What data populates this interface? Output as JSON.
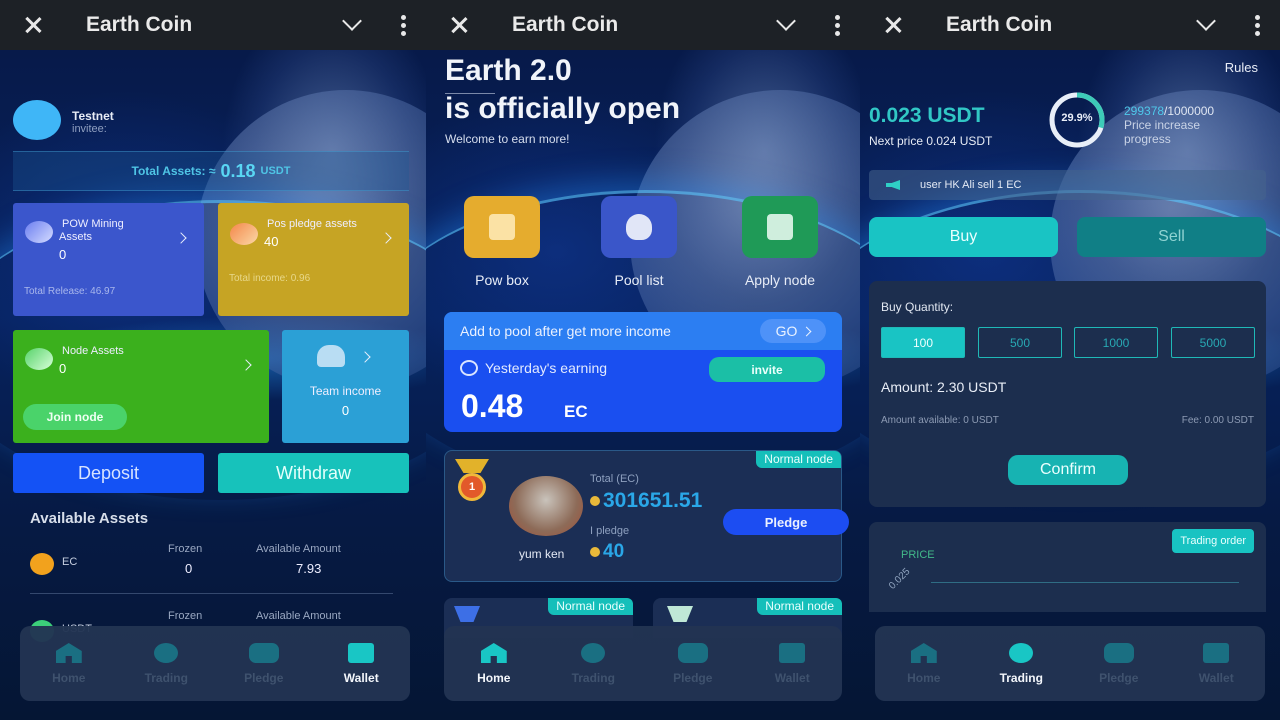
{
  "app": {
    "title": "Earth Coin",
    "close_icon": "close-icon",
    "collapse_icon": "chevron-down-icon",
    "menu_icon": "more-vertical-icon"
  },
  "tabs": [
    "Home",
    "Trading",
    "Pledge",
    "Wallet"
  ],
  "wallet": {
    "user_name": "Testnet",
    "invitee_label": "invitee:",
    "total_assets_label": "Total Assets: ≈",
    "total_assets_value": "0.18",
    "total_assets_unit": "USDT",
    "cards": {
      "pow": {
        "title_1": "POW Mining",
        "title_2": "Assets",
        "value": "0",
        "sub": "Total Release: 46.97",
        "color": "#3b56cc"
      },
      "pos": {
        "title": "Pos pledge assets",
        "value": "40",
        "sub": "Total income: 0.96",
        "color": "#c6a424"
      },
      "node": {
        "title": "Node Assets",
        "value": "0",
        "button": "Join node",
        "color": "#3bb01d"
      },
      "team": {
        "title": "Team income",
        "value": "0",
        "color": "#2ba0d6"
      }
    },
    "deposit_label": "Deposit",
    "withdraw_label": "Withdraw",
    "available_assets_title": "Available Assets",
    "assets": [
      {
        "symbol": "EC",
        "frozen_label": "Frozen",
        "frozen": "0",
        "available_label": "Available Amount",
        "available": "7.93"
      },
      {
        "symbol": "USDT",
        "frozen_label": "Frozen",
        "frozen": "",
        "available_label": "Available Amount",
        "available": ""
      }
    ],
    "active_tab": "Wallet"
  },
  "home": {
    "hero_line1": "Earth 2.0",
    "hero_line2": "is officially open",
    "hero_sub": "Welcome to earn more!",
    "quick_actions": [
      {
        "label": "Pow box",
        "icon": "gift-box-icon",
        "color": "#e5ac2e"
      },
      {
        "label": "Pool list",
        "icon": "trophy-icon",
        "color": "#3a56c9"
      },
      {
        "label": "Apply node",
        "icon": "chip-icon",
        "color": "#1f9a57"
      }
    ],
    "pool_banner": "Add to pool after get more income",
    "go_label": "GO",
    "yesterday_label": "Yesterday's earning",
    "invite_label": "invite",
    "earning_value": "0.48",
    "earning_unit": "EC",
    "node_card": {
      "badge": "Normal node",
      "rank": "1",
      "name": "yum ken",
      "total_label": "Total (EC)",
      "total_value": "301651.51",
      "pledge_label": "I pledge",
      "pledge_value": "40",
      "pledge_button": "Pledge"
    },
    "more_nodes": [
      {
        "badge": "Normal node"
      },
      {
        "badge": "Normal node"
      }
    ],
    "active_tab": "Home"
  },
  "trading": {
    "rules_label": "Rules",
    "current_price": "0.023 USDT",
    "next_price": "Next price 0.024 USDT",
    "progress_percent": 29.9,
    "progress_label": "29.9%",
    "progress_current": "299378",
    "progress_total": "/1000000",
    "progress_caption_1": "Price increase",
    "progress_caption_2": "progress",
    "ticker": "user HK Ali sell 1 EC",
    "buy_label": "Buy",
    "sell_label": "Sell",
    "buy_quantity_label": "Buy Quantity:",
    "quantities": [
      "100",
      "500",
      "1000",
      "5000"
    ],
    "selected_quantity": "100",
    "amount": "Amount: 2.30 USDT",
    "amount_available": "Amount available: 0 USDT",
    "fee": "Fee: 0.00 USDT",
    "confirm_label": "Confirm",
    "chart_label": "PRICE",
    "trading_order_label": "Trading order",
    "y_tick": "0.025",
    "active_tab": "Trading"
  }
}
